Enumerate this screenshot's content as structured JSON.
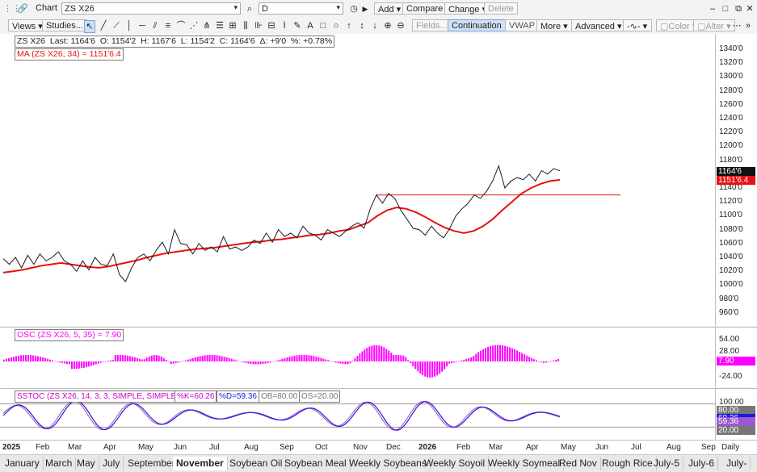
{
  "toolbar1": {
    "chart_label": "Chart",
    "symbol": "ZS X26",
    "interval": "D",
    "add": "Add",
    "compare": "Compare",
    "change": "Change",
    "delete": "Delete"
  },
  "toolbar2": {
    "views": "Views",
    "studies": "Studies...",
    "fields": "Fields...",
    "continuation": "Continuation",
    "vwap": "VWAP",
    "more": "More",
    "advanced": "Advanced",
    "color": "Color",
    "alter": "Alter"
  },
  "legend_main": {
    "symbol": "ZS X26",
    "last": "Last: 1164'6",
    "open": "O: 1154'2",
    "high": "H: 1167'6",
    "low": "L: 1154'2",
    "close": "C: 1164'6",
    "delta": "Δ: +9'0",
    "pct": "%: +0.78%"
  },
  "legend_ma": "MA (ZS X26, 34) = 1151'6.4",
  "legend_osc": "OSC (ZS X26, 5, 35) = 7.90",
  "legend_sstoc": {
    "name": "SSTOC (ZS X26, 14, 3, 3, SIMPLE, SIMPLE)",
    "k": "%K=60.26",
    "d": "%D=59.36",
    "ob": "OB=80.00",
    "os": "OS=20.00"
  },
  "price_axis": [
    "1340'0",
    "1320'0",
    "1300'0",
    "1280'0",
    "1260'0",
    "1240'0",
    "1220'0",
    "1200'0",
    "1180'0",
    "1160'0",
    "1140'0",
    "1120'0",
    "1100'0",
    "1080'0",
    "1060'0",
    "1040'0",
    "1020'0",
    "1000'0",
    "980'0",
    "960'0"
  ],
  "price_tags": {
    "last": "1164'6",
    "ma": "1151'6.4"
  },
  "osc_axis": [
    "54.00",
    "28.00",
    "-24.00"
  ],
  "osc_tag": "7.90",
  "sto_axis": [
    "100.00"
  ],
  "sto_tags": {
    "ob": "80.00",
    "k": "60.26",
    "d": "59.36",
    "os": "20.00"
  },
  "x_axis": [
    "2025",
    "Feb",
    "Mar",
    "Apr",
    "May",
    "Jun",
    "Jul",
    "Aug",
    "Sep",
    "Oct",
    "Nov",
    "Dec",
    "2026",
    "Feb",
    "Mar",
    "Apr",
    "May",
    "Jun",
    "Jul",
    "Aug",
    "Sep",
    "Daily"
  ],
  "tabs": [
    "January",
    "March",
    "May",
    "July",
    "September",
    "November",
    "Soybean Oil",
    "Soybean Meal",
    "Weekly Soybeans",
    "Weekly Soyoil",
    "Weekly Soymeal",
    "Red Nov",
    "Rough Rice",
    "July-5",
    "July-6",
    "July-"
  ],
  "selected_tab": "November",
  "colors": {
    "price": "#1a1a1a",
    "ma": "#e81010",
    "osc": "#ff00ff",
    "k": "#1a1ae0",
    "d": "#c060c0",
    "hline": "#e81010"
  },
  "chart_data": {
    "type": "line",
    "y_range": [
      950,
      1350
    ],
    "series": [
      {
        "name": "ZS X26",
        "values": [
          1038,
          1030,
          1040,
          1025,
          1043,
          1030,
          1045,
          1035,
          1040,
          1048,
          1035,
          1030,
          1020,
          1035,
          1022,
          1040,
          1030,
          1028,
          1045,
          1015,
          1005,
          1025,
          1040,
          1045,
          1035,
          1050,
          1062,
          1045,
          1080,
          1060,
          1058,
          1045,
          1060,
          1050,
          1055,
          1048,
          1070,
          1052,
          1055,
          1050,
          1055,
          1065,
          1060,
          1075,
          1062,
          1080,
          1070,
          1075,
          1068,
          1085,
          1075,
          1072,
          1065,
          1080,
          1075,
          1070,
          1078,
          1085,
          1090,
          1082,
          1110,
          1130,
          1118,
          1132,
          1125,
          1108,
          1095,
          1082,
          1080,
          1072,
          1085,
          1075,
          1068,
          1082,
          1100,
          1110,
          1118,
          1130,
          1125,
          1135,
          1150,
          1172,
          1140,
          1150,
          1155,
          1152,
          1160,
          1150,
          1165,
          1160,
          1168,
          1164.75
        ]
      },
      {
        "name": "MA (ZS X26, 34)",
        "values": [
          1018,
          1020,
          1022,
          1025,
          1028,
          1030,
          1032,
          1030,
          1028,
          1026,
          1025,
          1027,
          1030,
          1033,
          1036,
          1040,
          1043,
          1046,
          1048,
          1050,
          1052,
          1053,
          1054,
          1056,
          1058,
          1060,
          1062,
          1063,
          1065,
          1066,
          1068,
          1070,
          1072,
          1073,
          1075,
          1078,
          1080,
          1085,
          1090,
          1100,
          1108,
          1112,
          1110,
          1105,
          1098,
          1090,
          1083,
          1078,
          1075,
          1078,
          1085,
          1095,
          1108,
          1120,
          1132,
          1140,
          1146,
          1150,
          1151.8
        ]
      }
    ]
  }
}
